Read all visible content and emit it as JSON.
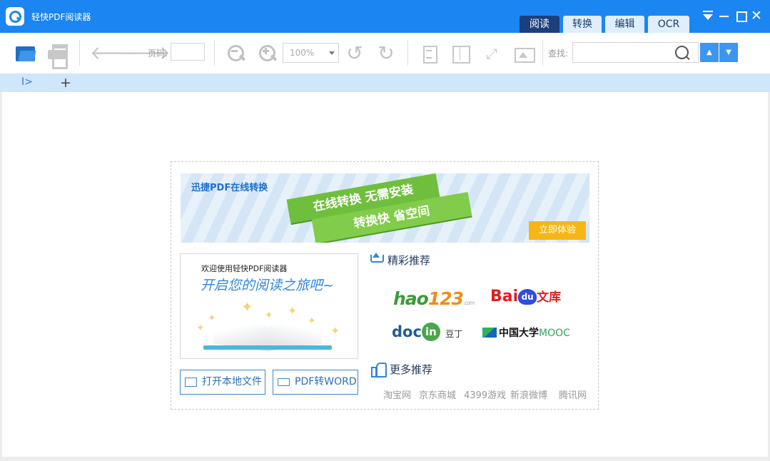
{
  "app": {
    "title": "轻快PDF阅读器"
  },
  "tabs": [
    {
      "label": "阅读",
      "active": true
    },
    {
      "label": "转换"
    },
    {
      "label": "编辑"
    },
    {
      "label": "OCR"
    }
  ],
  "window_controls": {
    "close_glyph": "✕"
  },
  "toolbar": {
    "open_plus": "+",
    "page_label": "页码:",
    "page_value": "",
    "zoom_value": "100%",
    "find_label": "查找:",
    "search_value": "",
    "back_glyph": "🡐",
    "forward_glyph": "🡒",
    "rotate_left_glyph": "↺",
    "rotate_right_glyph": "↻",
    "fullscreen_glyph": "⤢",
    "prev_glyph": "▲",
    "next_glyph": "▼"
  },
  "tabstrip": {
    "sidebar_glyph": "I>",
    "new_tab_glyph": "+"
  },
  "banner": {
    "title": "迅捷PDF在线转换",
    "line1": "在线转换 无需安装",
    "line2": "转换快  省空间",
    "cta": "立即体验"
  },
  "welcome": {
    "line1": "欢迎使用轻快PDF阅读器",
    "line2": "开启您的阅读之旅吧~"
  },
  "actions": {
    "open_local": "打开本地文件",
    "pdf_word": "PDF转WORD"
  },
  "featured": {
    "title": "精彩推荐",
    "hao123_a": "hao",
    "hao123_b": "123",
    "hao123_c": ".com",
    "baidu_a": "Bai",
    "baidu_b": "du",
    "baidu_c": "文库",
    "docin_a": "doc",
    "docin_b": "in",
    "docin_c": "豆丁",
    "mooc_a": "中国大学",
    "mooc_b": "MOOC"
  },
  "more": {
    "title": "更多推荐",
    "links": [
      "淘宝网",
      "京东商城",
      "4399游戏",
      "新浪微博",
      "腾讯网"
    ]
  },
  "colors": {
    "titlebar": "#1b86f2",
    "tab_active": "#1a3f7c",
    "ribbon": "#6fbf3c",
    "cta": "#f5b616"
  }
}
